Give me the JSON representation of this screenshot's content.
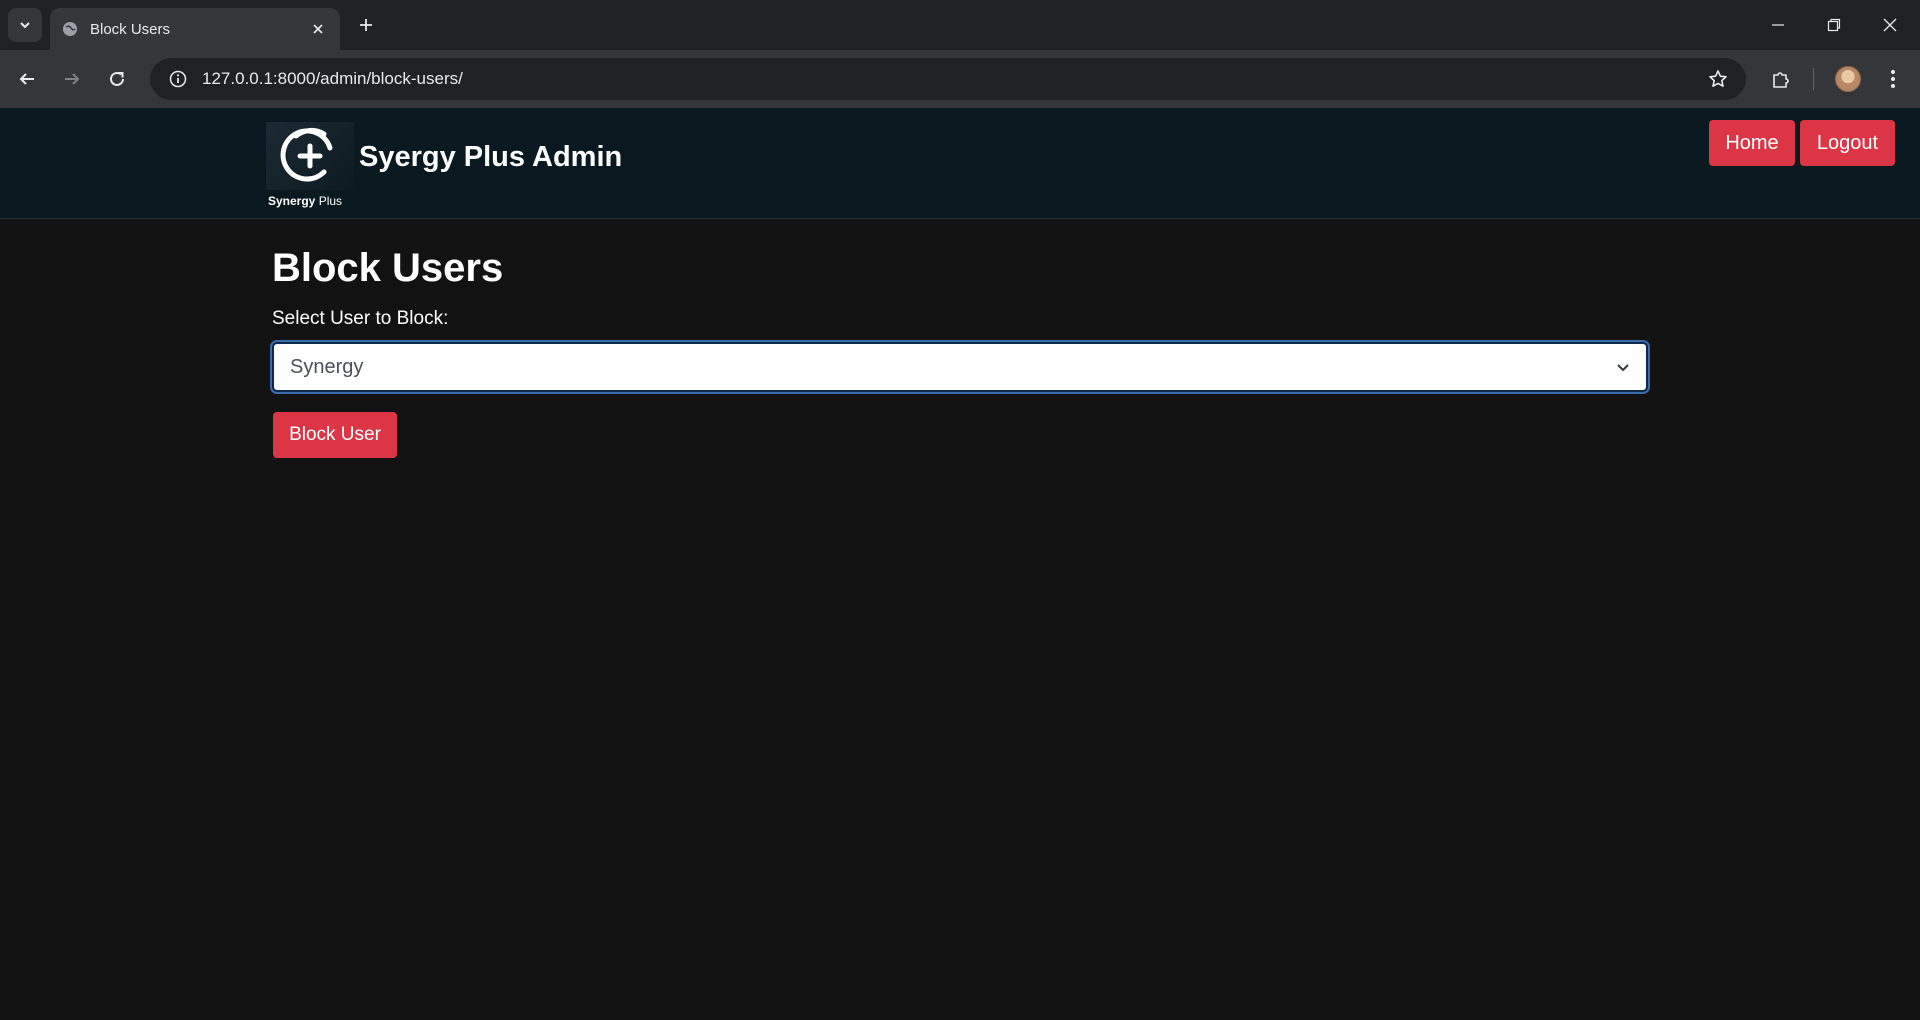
{
  "browser": {
    "tab_title": "Block Users",
    "url": "127.0.0.1:8000/admin/block-users/"
  },
  "header": {
    "logo_text_bold": "Synergy",
    "logo_text_light": "Plus",
    "site_title": "Syergy Plus Admin",
    "nav": [
      "Home",
      "Logout"
    ]
  },
  "main": {
    "title": "Block Users",
    "select_label": "Select User to Block:",
    "selected_user": "Synergy",
    "submit_label": "Block User"
  },
  "colors": {
    "accent": "#dc3545",
    "header_bg": "#0a1820",
    "page_bg": "#121212"
  }
}
